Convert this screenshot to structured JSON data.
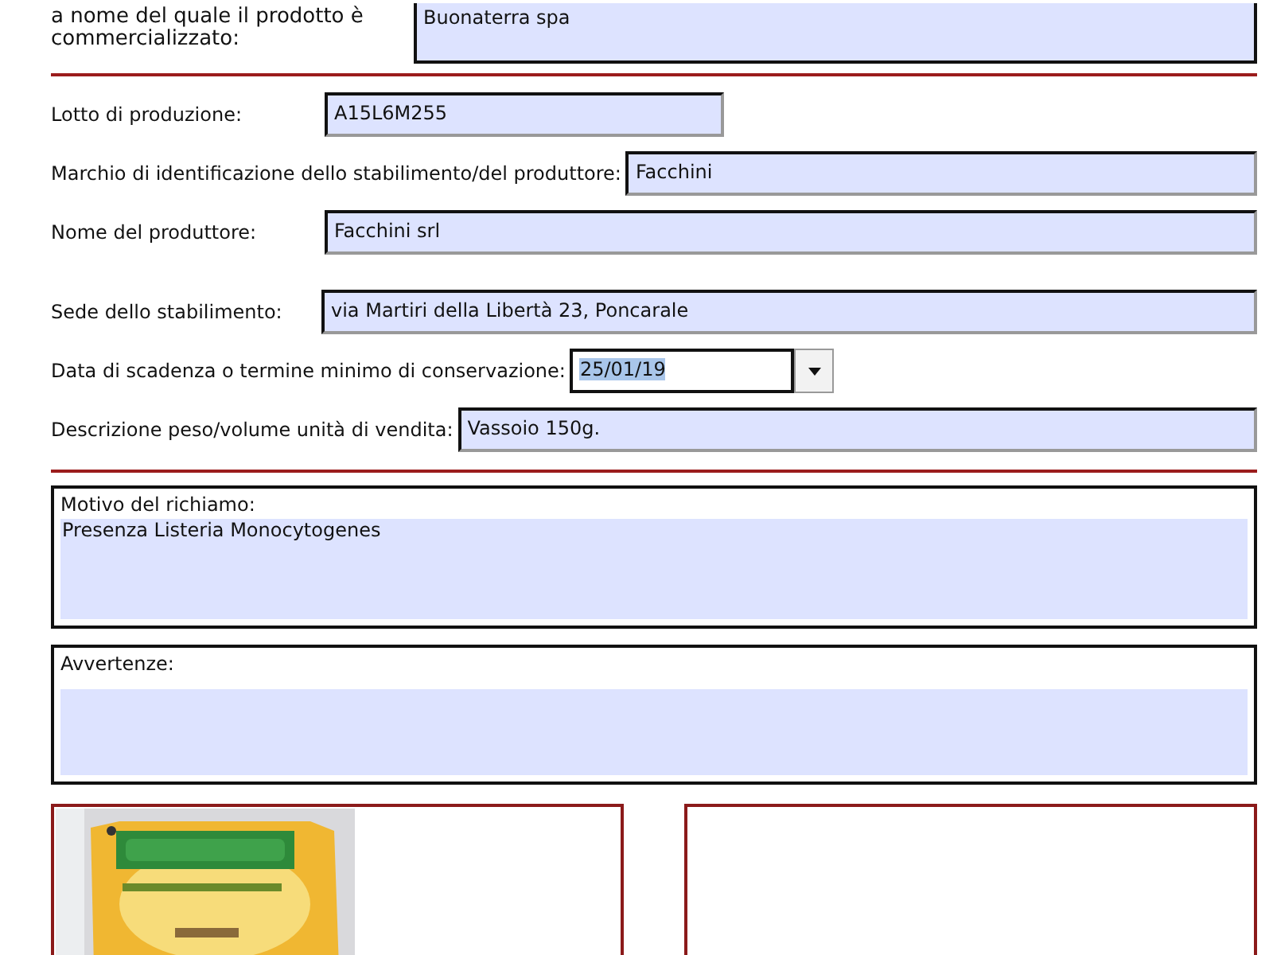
{
  "top_field": {
    "label_lines": [
      "a nome del quale il prodotto è",
      "commercializzato:"
    ],
    "value": "Buonaterra spa"
  },
  "fields": [
    {
      "kind": "text",
      "label": "Lotto di produzione:",
      "value": "A15L6M255"
    },
    {
      "kind": "text",
      "label": "Marchio di identificazione dello stabilimento/del produttore:",
      "value": "Facchini"
    },
    {
      "kind": "text",
      "label": "Nome del produttore:",
      "value": "Facchini srl"
    },
    {
      "kind": "text",
      "label": "Sede dello stabilimento:",
      "value": "via Martiri della Libertà 23, Poncarale"
    },
    {
      "kind": "dropdown",
      "label": "Data di scadenza o termine minimo di conservazione:",
      "value": "25/01/19"
    },
    {
      "kind": "text",
      "label": "Descrizione peso/volume unità di vendita:",
      "value": "Vassoio 150g."
    }
  ],
  "text_areas": [
    {
      "label": "Motivo del richiamo:",
      "value": "Presenza Listeria Monocytogenes"
    },
    {
      "label": "Avvertenze:"
    }
  ],
  "image_boxes": [
    {
      "kind": "picture"
    },
    {
      "kind": "empty"
    }
  ]
}
